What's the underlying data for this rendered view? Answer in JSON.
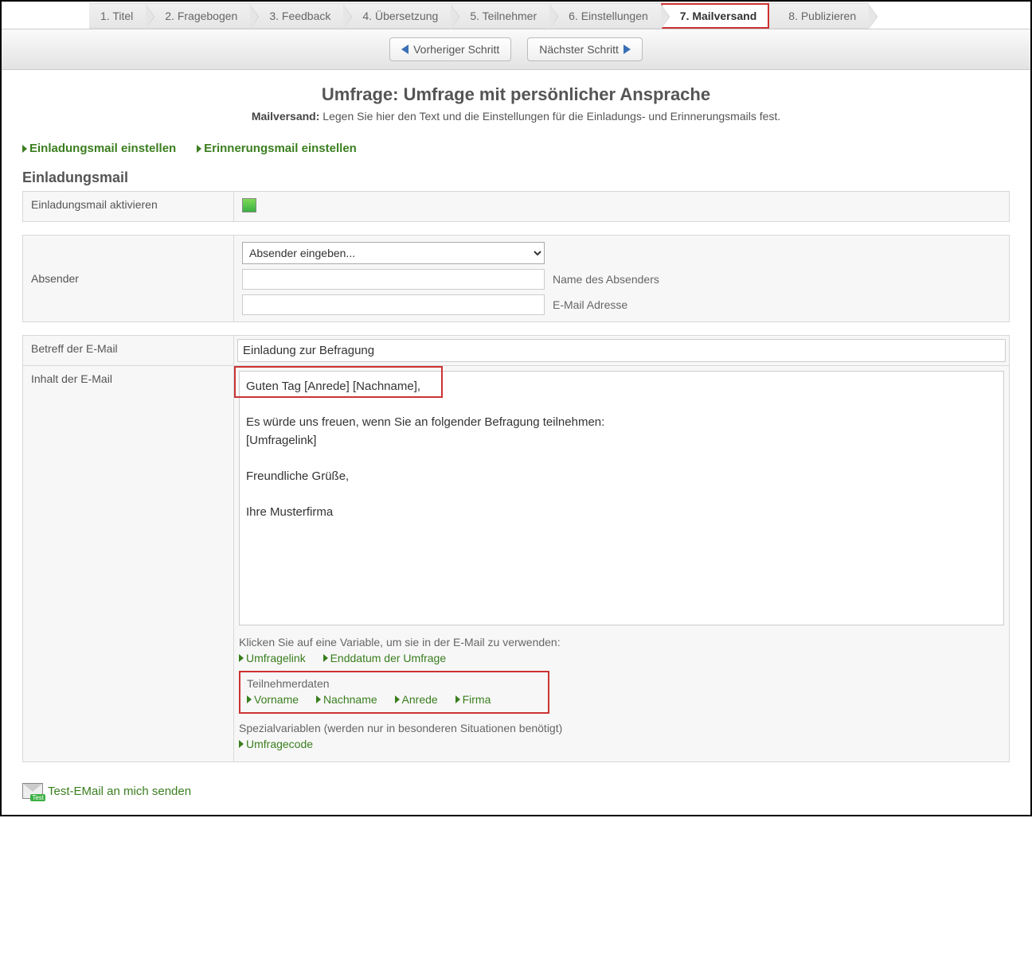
{
  "steps": [
    {
      "label": "1. Titel"
    },
    {
      "label": "2. Fragebogen"
    },
    {
      "label": "3. Feedback"
    },
    {
      "label": "4. Übersetzung"
    },
    {
      "label": "5. Teilnehmer"
    },
    {
      "label": "6. Einstellungen"
    },
    {
      "label": "7. Mailversand",
      "active": true
    },
    {
      "label": "8. Publizieren"
    }
  ],
  "nav": {
    "prev": "Vorheriger Schritt",
    "next": "Nächster Schritt"
  },
  "title": "Umfrage: Umfrage mit persönlicher Ansprache",
  "subtitle_label": "Mailversand:",
  "subtitle_text": "Legen Sie hier den Text und die Einstellungen für die Einladungs- und Erinnerungsmails fest.",
  "tabs": {
    "invite": "Einladungsmail einstellen",
    "reminder": "Erinnerungsmail einstellen"
  },
  "section_heading": "Einladungsmail",
  "form": {
    "activate_label": "Einladungsmail aktivieren",
    "sender_label": "Absender",
    "sender_select": "Absender eingeben...",
    "sender_name_label": "Name des Absenders",
    "sender_email_label": "E-Mail Adresse",
    "subject_label": "Betreff der E-Mail",
    "subject_value": "Einladung zur Befragung",
    "content_label": "Inhalt der E-Mail",
    "content_value": "Guten Tag [Anrede] [Nachname],\n\nEs würde uns freuen, wenn Sie an folgender Befragung teilnehmen:\n[Umfragelink]\n\nFreundliche Grüße,\n\nIhre Musterfirma",
    "var_hint": "Klicken Sie auf eine Variable, um sie in der E-Mail zu verwenden:",
    "var_links1": [
      {
        "label": "Umfragelink"
      },
      {
        "label": "Enddatum der Umfrage"
      }
    ],
    "participant_label": "Teilnehmerdaten",
    "participant_links": [
      {
        "label": "Vorname"
      },
      {
        "label": "Nachname"
      },
      {
        "label": "Anrede"
      },
      {
        "label": "Firma"
      }
    ],
    "special_label": "Spezialvariablen (werden nur in besonderen Situationen benötigt)",
    "special_links": [
      {
        "label": "Umfragecode"
      }
    ]
  },
  "footer": {
    "test_mail": "Test-EMail an mich senden",
    "test_badge": "Test"
  }
}
